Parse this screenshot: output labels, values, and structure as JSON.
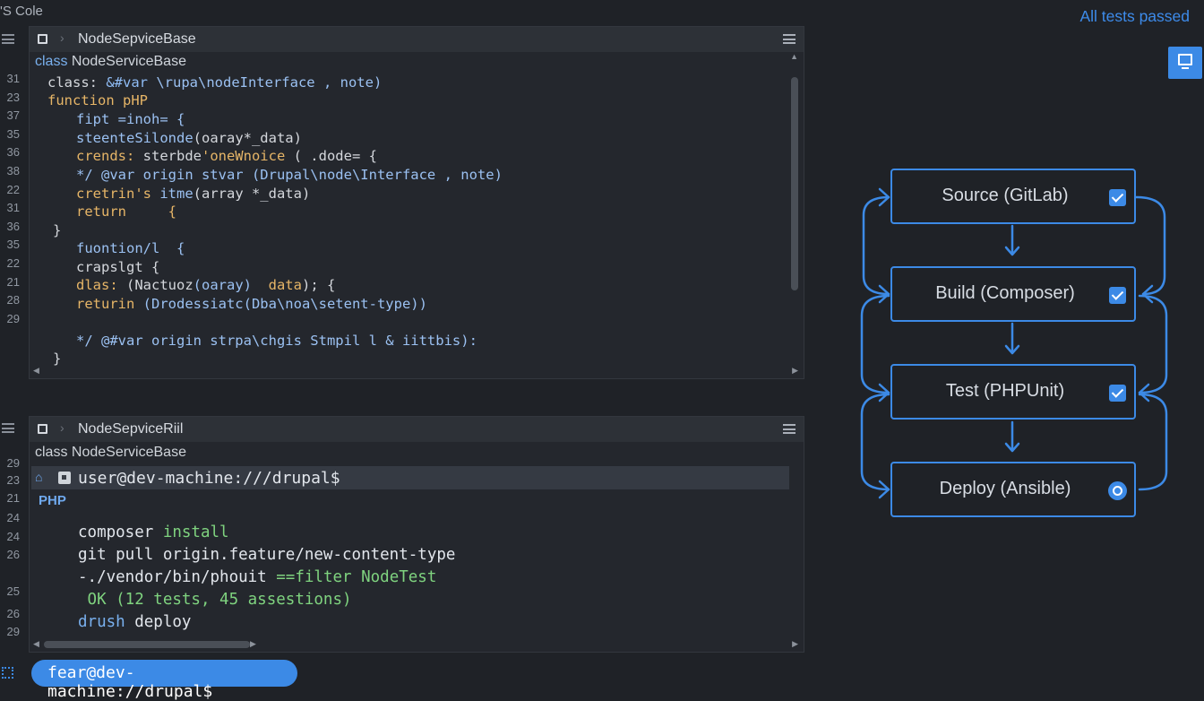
{
  "app": {
    "title": "'S Cole"
  },
  "status_top": {
    "tests_passed": "All tests passed"
  },
  "editor": {
    "tab_title": "NodeSepviceBase",
    "class_line": {
      "keyword": "class",
      "name": "NodeServiceBase"
    },
    "line_numbers": [
      "31",
      "23",
      "37",
      "35",
      "36",
      "38",
      "22",
      "31",
      "36",
      "35",
      "22",
      "21",
      "28",
      "29"
    ],
    "lines": [
      [
        {
          "t": "class: ",
          "c": "#d4d7dc"
        },
        {
          "t": "&#var ",
          "c": "#8fbcf5"
        },
        {
          "t": "\\rupa\\nodeInterface , note)",
          "c": "#9bc1f2"
        }
      ],
      [
        {
          "t": "function pHP",
          "c": "#e6b567"
        }
      ],
      [
        {
          "t": "fipt =inoh= {",
          "c": "#9bc1f2"
        }
      ],
      [
        {
          "t": "steenteSilonde",
          "c": "#9bc1f2"
        },
        {
          "t": "(oaray*_data)",
          "c": "#d4d7dc"
        }
      ],
      [
        {
          "t": "crends: ",
          "c": "#e6b567"
        },
        {
          "t": "sterbde",
          "c": "#d4d7dc"
        },
        {
          "t": "'oneWnoice ",
          "c": "#e6b567"
        },
        {
          "t": "( .dode= {",
          "c": "#d4d7dc"
        }
      ],
      [
        {
          "t": "*/ @var origin stvar ",
          "c": "#9bc1f2"
        },
        {
          "t": "(Drupal\\node\\Interface , note)",
          "c": "#9bc1f2"
        }
      ],
      [
        {
          "t": "cretrin's ",
          "c": "#e6b567"
        },
        {
          "t": "itme",
          "c": "#9bc1f2"
        },
        {
          "t": "(array *_data)",
          "c": "#d4d7dc"
        }
      ],
      [
        {
          "t": "return     {",
          "c": "#e6b567"
        }
      ],
      [
        {
          "t": "}",
          "c": "#d4d7dc"
        }
      ],
      [
        {
          "t": "fuontion/l  {",
          "c": "#9bc1f2"
        }
      ],
      [
        {
          "t": "crapslgt {",
          "c": "#d4d7dc"
        }
      ],
      [
        {
          "t": "dlas: ",
          "c": "#e6b567"
        },
        {
          "t": "(Nactuoz",
          "c": "#d4d7dc"
        },
        {
          "t": "(oaray) ",
          "c": "#9bc1f2"
        },
        {
          "t": " data",
          "c": "#e6b567"
        },
        {
          "t": "); {",
          "c": "#d4d7dc"
        }
      ],
      [
        {
          "t": "returin ",
          "c": "#e6b567"
        },
        {
          "t": "(Drodessiatc(Dba\\noa\\setent-type))",
          "c": "#9bc1f2"
        }
      ],
      [
        {
          "t": "*/ @#var origin strpa\\chgis Stmpil l & iittbis):",
          "c": "#9bc1f2"
        }
      ],
      [
        {
          "t": "}",
          "c": "#d4d7dc"
        }
      ]
    ]
  },
  "terminal": {
    "tab_title": "NodeSepviceRiil",
    "class_line": "class NodeServiceBase",
    "line_numbers": [
      "29",
      "23",
      "21",
      "24",
      "24",
      "26",
      "25",
      "26",
      "29"
    ],
    "prompt": "user@dev-machine:///drupal$",
    "language": "PHP",
    "lines": [
      [
        {
          "t": "composer ",
          "c": "#e2e6ec"
        },
        {
          "t": "install",
          "c": "#7fd37f"
        }
      ],
      [
        {
          "t": "git pull origin.feature/new-content-type",
          "c": "#e2e6ec"
        }
      ],
      [
        {
          "t": "-./vendor/bin/phouit ",
          "c": "#e2e6ec"
        },
        {
          "t": "==filter NodeTest",
          "c": "#7fd37f"
        }
      ],
      [
        {
          "t": " OK (12 tests, 45 assestions)",
          "c": "#7fd37f"
        }
      ],
      [
        {
          "t": "drush ",
          "c": "#79b0ee"
        },
        {
          "t": "deploy",
          "c": "#e2e6ec"
        }
      ]
    ]
  },
  "statusbar": {
    "prompt": "fear@dev-machine://drupal$"
  },
  "pipeline": {
    "stages": [
      {
        "label": "Source (GitLab)",
        "state": "done"
      },
      {
        "label": "Build (Composer)",
        "state": "done"
      },
      {
        "label": "Test (PHPUnit)",
        "state": "done"
      },
      {
        "label": "Deploy (Ansible)",
        "state": "pending"
      }
    ]
  }
}
